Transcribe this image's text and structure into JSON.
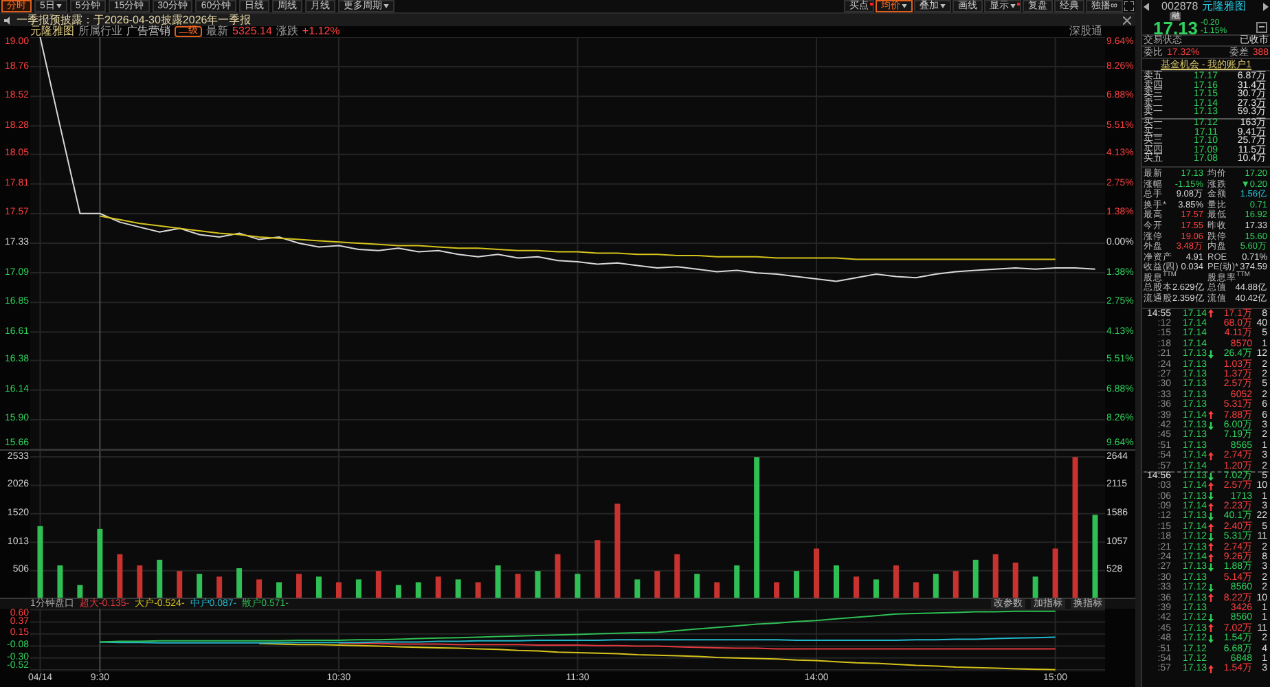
{
  "toolbar": {
    "periods": [
      {
        "label": "分时",
        "selected": true,
        "dropdown": false
      },
      {
        "label": "5日",
        "selected": false,
        "dropdown": true
      },
      {
        "label": "5分钟",
        "selected": false,
        "dropdown": false
      },
      {
        "label": "15分钟",
        "selected": false,
        "dropdown": false
      },
      {
        "label": "30分钟",
        "selected": false,
        "dropdown": false
      },
      {
        "label": "60分钟",
        "selected": false,
        "dropdown": false
      },
      {
        "label": "日线",
        "selected": false,
        "dropdown": false
      },
      {
        "label": "周线",
        "selected": false,
        "dropdown": false
      },
      {
        "label": "月线",
        "selected": false,
        "dropdown": false
      },
      {
        "label": "更多周期",
        "selected": false,
        "dropdown": true
      }
    ],
    "tools": [
      {
        "label": "买点",
        "selected": false,
        "dropdown": false,
        "dot": true
      },
      {
        "label": "均价",
        "selected": true,
        "dropdown": true,
        "dot": false
      },
      {
        "label": "叠加",
        "selected": false,
        "dropdown": true,
        "dot": false
      },
      {
        "label": "画线",
        "selected": false,
        "dropdown": false,
        "dot": false
      },
      {
        "label": "显示",
        "selected": false,
        "dropdown": true,
        "dot": true
      },
      {
        "label": "复盘",
        "selected": false,
        "dropdown": false,
        "dot": false
      },
      {
        "label": "经典",
        "selected": false,
        "dropdown": false,
        "dot": false
      },
      {
        "label": "独播∞",
        "selected": false,
        "dropdown": false,
        "dot": false
      }
    ]
  },
  "notice": {
    "text": "一季报预披露：于2026-04-30披露2026年一季报"
  },
  "stock_header": {
    "name": "元隆雅图",
    "industry_label": "所属行业",
    "industry": "广告营销",
    "level_badge": "二级",
    "latest_label": "最新",
    "latest": "5325.14",
    "change_label": "涨跌",
    "change": "+1.12%",
    "connect": "深股通"
  },
  "price_chart": {
    "chart_data": {
      "type": "line",
      "grid": true,
      "ylim": [
        15.66,
        19.0
      ],
      "yticks": [
        {
          "value": 19.0,
          "label": "19.00"
        },
        {
          "value": 18.76,
          "label": "18.76"
        },
        {
          "value": 18.52,
          "label": "18.52"
        },
        {
          "value": 18.28,
          "label": "18.28"
        },
        {
          "value": 18.05,
          "label": "18.05"
        },
        {
          "value": 17.81,
          "label": "17.81"
        },
        {
          "value": 17.57,
          "label": "17.57"
        },
        {
          "value": 17.33,
          "label": "17.33"
        },
        {
          "value": 17.09,
          "label": "17.09"
        },
        {
          "value": 16.85,
          "label": "16.85"
        },
        {
          "value": 16.61,
          "label": "16.61"
        },
        {
          "value": 16.38,
          "label": "16.38"
        },
        {
          "value": 16.14,
          "label": "16.14"
        },
        {
          "value": 15.9,
          "label": "15.90"
        },
        {
          "value": 15.66,
          "label": "15.66"
        }
      ],
      "series": [
        {
          "color": "#d9d9d9",
          "values": [
            19.0,
            18.28,
            17.57,
            17.57,
            17.5,
            17.46,
            17.42,
            17.45,
            17.4,
            17.38,
            17.41,
            17.36,
            17.38,
            17.33,
            17.3,
            17.31,
            17.28,
            17.27,
            17.29,
            17.26,
            17.27,
            17.24,
            17.22,
            17.24,
            17.21,
            17.22,
            17.19,
            17.18,
            17.16,
            17.17,
            17.15,
            17.13,
            17.14,
            17.12,
            17.1,
            17.11,
            17.09,
            17.08,
            17.06,
            17.04,
            17.02,
            17.05,
            17.08,
            17.06,
            17.05,
            17.08,
            17.1,
            17.11,
            17.12,
            17.13,
            17.12,
            17.13,
            17.13,
            17.12
          ]
        },
        {
          "color": "#d6c31c",
          "values": [
            null,
            null,
            null,
            17.55,
            17.52,
            17.49,
            17.47,
            17.45,
            17.43,
            17.41,
            17.4,
            17.38,
            17.37,
            17.36,
            17.35,
            17.34,
            17.33,
            17.32,
            17.31,
            17.31,
            17.3,
            17.29,
            17.29,
            17.28,
            17.27,
            17.27,
            17.26,
            17.26,
            17.25,
            17.25,
            17.24,
            17.24,
            17.23,
            17.23,
            17.22,
            17.22,
            17.22,
            17.21,
            17.21,
            17.21,
            17.21,
            17.2,
            17.2,
            17.2,
            17.2,
            17.2,
            17.2,
            17.2,
            17.2,
            17.2,
            17.2,
            17.2,
            null,
            null
          ]
        }
      ]
    },
    "pct_labels": [
      "9.64%",
      "8.26%",
      "6.88%",
      "5.51%",
      "4.13%",
      "2.75%",
      "1.38%",
      "0.00%",
      "1.38%",
      "2.75%",
      "4.13%",
      "5.51%",
      "6.88%",
      "8.26%",
      "9.64%"
    ]
  },
  "volume_chart": {
    "chart_data": {
      "type": "bar",
      "stacked": true,
      "grid": true,
      "ylim": [
        0,
        2644
      ],
      "yticks": [
        {
          "value": 2533,
          "label": "2533"
        },
        {
          "value": 2026,
          "label": "2026"
        },
        {
          "value": 1520,
          "label": "1520"
        },
        {
          "value": 1013,
          "label": "1013"
        },
        {
          "value": 506,
          "label": "506"
        }
      ],
      "series": [
        {
          "color": "#c8332f",
          "values": [
            null,
            null,
            null,
            null,
            800,
            600,
            null,
            500,
            null,
            400,
            null,
            350,
            null,
            450,
            null,
            300,
            null,
            500,
            null,
            null,
            400,
            null,
            300,
            null,
            450,
            null,
            800,
            null,
            1050,
            1700,
            null,
            500,
            800,
            null,
            300,
            null,
            null,
            300,
            null,
            900,
            null,
            400,
            null,
            600,
            300,
            null,
            500,
            null,
            800,
            650,
            null,
            900,
            2530,
            null
          ]
        },
        {
          "color": "#2fbf55",
          "values": [
            1300,
            600,
            250,
            1250,
            null,
            null,
            700,
            null,
            450,
            null,
            550,
            null,
            300,
            null,
            400,
            null,
            350,
            null,
            250,
            300,
            null,
            350,
            null,
            600,
            null,
            500,
            null,
            450,
            null,
            null,
            350,
            null,
            null,
            450,
            null,
            600,
            2530,
            null,
            500,
            null,
            600,
            null,
            350,
            null,
            null,
            450,
            null,
            700,
            null,
            null,
            400,
            null,
            null,
            1500
          ]
        }
      ]
    },
    "right_labels": [
      "2644",
      "2115",
      "1586",
      "1057",
      "528"
    ]
  },
  "indicator": {
    "title": "1分钟盘口",
    "legend": [
      "-0.135-",
      "-0.524-",
      "0.087-",
      "0.571-"
    ],
    "actions": [
      "改参数",
      "加指标",
      "换指标"
    ],
    "chart_data": {
      "type": "line",
      "grid": true,
      "ylim": [
        -0.56,
        0.62
      ],
      "yticks": [
        {
          "value": 0.6,
          "label": "0.60"
        },
        {
          "value": 0.37,
          "label": "0.37"
        },
        {
          "value": 0.15,
          "label": "0.15"
        },
        {
          "value": -0.08,
          "label": "-0.08"
        },
        {
          "value": -0.3,
          "label": "-0.30"
        },
        {
          "value": -0.52,
          "label": "-0.52"
        }
      ],
      "categories": [
        "04/14",
        null,
        null,
        "9:30",
        null,
        null,
        null,
        null,
        null,
        null,
        null,
        null,
        null,
        null,
        null,
        "10:30",
        null,
        null,
        null,
        null,
        null,
        null,
        null,
        null,
        null,
        null,
        null,
        "11:30",
        null,
        null,
        null,
        null,
        null,
        null,
        null,
        null,
        null,
        null,
        null,
        "14:00",
        null,
        null,
        null,
        null,
        null,
        null,
        null,
        null,
        null,
        null,
        null,
        "15:00",
        null,
        null
      ],
      "series": [
        {
          "name": "超大",
          "color": "#e0393e",
          "values": [
            null,
            null,
            null,
            null,
            null,
            null,
            null,
            null,
            null,
            null,
            null,
            null,
            null,
            null,
            null,
            -0.02,
            -0.03,
            -0.03,
            -0.04,
            -0.04,
            -0.04,
            -0.05,
            -0.05,
            -0.05,
            -0.05,
            -0.06,
            -0.06,
            -0.06,
            -0.07,
            -0.07,
            -0.08,
            -0.08,
            -0.09,
            -0.1,
            -0.11,
            -0.12,
            -0.12,
            -0.13,
            -0.13,
            -0.13,
            -0.13,
            -0.13,
            -0.13,
            -0.13,
            -0.13,
            -0.13,
            -0.13,
            -0.13,
            -0.13,
            -0.13,
            -0.13,
            -0.13,
            null,
            null
          ]
        },
        {
          "name": "大户",
          "color": "#d6c31c",
          "values": [
            null,
            null,
            null,
            null,
            null,
            null,
            null,
            null,
            null,
            null,
            null,
            -0.03,
            -0.04,
            -0.05,
            -0.05,
            -0.06,
            -0.07,
            -0.08,
            -0.09,
            -0.1,
            -0.11,
            -0.12,
            -0.13,
            -0.14,
            -0.16,
            -0.17,
            -0.19,
            -0.2,
            -0.21,
            -0.22,
            -0.24,
            -0.25,
            -0.26,
            -0.27,
            -0.29,
            -0.3,
            -0.31,
            -0.32,
            -0.34,
            -0.35,
            -0.37,
            -0.39,
            -0.4,
            -0.42,
            -0.44,
            -0.45,
            -0.47,
            -0.48,
            -0.49,
            -0.5,
            -0.51,
            -0.52,
            null,
            null
          ]
        },
        {
          "name": "中户",
          "color": "#22b8cc",
          "values": [
            null,
            null,
            null,
            0,
            -0.01,
            -0.01,
            -0.02,
            -0.02,
            -0.02,
            -0.02,
            -0.02,
            -0.02,
            -0.02,
            -0.01,
            -0.01,
            -0.01,
            -0.01,
            0,
            0,
            0,
            0.01,
            0.01,
            0.02,
            0.02,
            0.02,
            0.03,
            0.03,
            0.03,
            0.03,
            0.04,
            0.04,
            0.04,
            0.04,
            0.04,
            0.04,
            0.04,
            0.04,
            0.04,
            0.03,
            0.03,
            0.03,
            0.03,
            0.03,
            0.03,
            0.04,
            0.04,
            0.05,
            0.05,
            0.06,
            0.07,
            0.08,
            0.09,
            null,
            null
          ]
        },
        {
          "name": "散户",
          "color": "#2fbf55",
          "values": [
            null,
            null,
            null,
            0,
            0.01,
            0.01,
            0.02,
            0.02,
            0.02,
            0.02,
            0.02,
            0.02,
            0.02,
            0.03,
            0.03,
            0.03,
            0.04,
            0.04,
            0.05,
            0.06,
            0.07,
            0.08,
            0.09,
            0.1,
            0.11,
            0.12,
            0.13,
            0.14,
            0.15,
            0.16,
            0.17,
            0.18,
            0.21,
            0.24,
            0.27,
            0.3,
            0.33,
            0.35,
            0.38,
            0.4,
            0.43,
            0.46,
            0.49,
            0.52,
            0.53,
            0.54,
            0.55,
            0.56,
            0.56,
            0.57,
            0.57,
            0.57,
            null,
            null
          ]
        }
      ]
    }
  },
  "quote": {
    "code": "002878",
    "name": "元隆雅图",
    "badge": "融",
    "price": "17.13",
    "change": "-0.20",
    "change_pct": "-1.15%"
  },
  "status": {
    "label": "交易状态",
    "value": "已收市"
  },
  "ratio": [
    {
      "label": "委比",
      "value": "17.32%"
    },
    {
      "label": "委差",
      "value": "388"
    }
  ],
  "link": "基金机会 - 我的账户1",
  "order_book": {
    "asks": [
      {
        "label": "卖五",
        "price": "17.17",
        "volume": "6.87万"
      },
      {
        "label": "卖四",
        "price": "17.16",
        "volume": "31.4万"
      },
      {
        "label": "卖三",
        "price": "17.15",
        "volume": "30.7万"
      },
      {
        "label": "卖二",
        "price": "17.14",
        "volume": "27.3万"
      },
      {
        "label": "卖一",
        "price": "17.13",
        "volume": "59.3万"
      }
    ],
    "bids": [
      {
        "label": "买一",
        "price": "17.12",
        "volume": "163万"
      },
      {
        "label": "买二",
        "price": "17.11",
        "volume": "9.41万"
      },
      {
        "label": "买三",
        "price": "17.10",
        "volume": "25.7万"
      },
      {
        "label": "买四",
        "price": "17.09",
        "volume": "11.5万"
      },
      {
        "label": "买五",
        "price": "17.08",
        "volume": "10.4万"
      }
    ]
  },
  "stats": [
    {
      "left": {
        "label": "最新",
        "value": "17.13",
        "color": "#2fd25c"
      },
      "right": {
        "label": "均价",
        "value": "17.20",
        "color": "#2fd25c"
      }
    },
    {
      "left": {
        "label": "涨幅",
        "value": "-1.15%",
        "color": "#2fd25c"
      },
      "right": {
        "label": "涨跌",
        "value": "▼0.20",
        "color": "#2fd25c"
      }
    },
    {
      "left": {
        "label": "总手",
        "value": "9.08万",
        "color": "#d8d8d8"
      },
      "right": {
        "label": "金额",
        "value": "1.56亿",
        "color": "#22c7e0"
      }
    },
    {
      "left": {
        "label": "换手*",
        "value": "3.85%",
        "color": "#d8d8d8"
      },
      "right": {
        "label": "量比",
        "value": "0.71",
        "color": "#2fd25c"
      }
    },
    {
      "left": {
        "label": "最高",
        "value": "17.57",
        "color": "#ff4040"
      },
      "right": {
        "label": "最低",
        "value": "16.92",
        "color": "#2fd25c"
      }
    },
    {
      "left": {
        "label": "今开",
        "value": "17.55",
        "color": "#ff4040"
      },
      "right": {
        "label": "昨收",
        "value": "17.33",
        "color": "#d8d8d8"
      }
    },
    {
      "left": {
        "label": "涨停",
        "value": "19.06",
        "color": "#ff4040"
      },
      "right": {
        "label": "跌停",
        "value": "15.60",
        "color": "#2fd25c"
      }
    },
    {
      "left": {
        "label": "外盘",
        "value": "3.48万",
        "color": "#ff4040"
      },
      "right": {
        "label": "内盘",
        "value": "5.60万",
        "color": "#2fd25c"
      }
    },
    {
      "left": {
        "label": "净资产",
        "value": "4.91",
        "color": "#d8d8d8"
      },
      "right": {
        "label": "ROE",
        "value": "0.71%",
        "color": "#d8d8d8"
      }
    },
    {
      "left": {
        "label": "收益(四)",
        "value": "0.034",
        "color": "#d8d8d8"
      },
      "right": {
        "label": "PE(动)*",
        "value": "374.59",
        "color": "#d8d8d8"
      }
    },
    {
      "left": {
        "label": "股息$^{TTM}$"
      },
      "right": {
        "label": "股息率$^{TTM}$"
      }
    },
    {
      "left": {
        "label": "总股本",
        "value": "2.629亿",
        "color": "#d8d8d8"
      },
      "right": {
        "label": "总值",
        "value": "44.88亿",
        "color": "#d8d8d8"
      }
    },
    {
      "left": {
        "label": "流通股",
        "value": "2.359亿",
        "color": "#d8d8d8"
      },
      "right": {
        "label": "流值",
        "value": "40.42亿",
        "color": "#d8d8d8"
      }
    }
  ],
  "ticks": [
    {
      "new_minute": true,
      "time": "14:55",
      "price": "17.14",
      "kind": "up",
      "volume": "17.1万",
      "color": "#ff4040",
      "count": "8"
    },
    {
      "new_minute": false,
      "time": ":12",
      "price": "17.14",
      "kind": "flat",
      "volume": "68.0万",
      "color": "#ff4040",
      "count": "40"
    },
    {
      "new_minute": false,
      "time": ":15",
      "price": "17.14",
      "kind": "flat",
      "volume": "4.11万",
      "color": "#ff4040",
      "count": "5"
    },
    {
      "new_minute": false,
      "time": ":18",
      "price": "17.14",
      "kind": "flat",
      "volume": "8570",
      "color": "#ff4040",
      "count": "1"
    },
    {
      "new_minute": false,
      "time": ":21",
      "price": "17.13",
      "kind": "down",
      "volume": "26.4万",
      "color": "#2fd25c",
      "count": "12"
    },
    {
      "new_minute": false,
      "time": ":24",
      "price": "17.13",
      "kind": "flat",
      "volume": "1.03万",
      "color": "#ff4040",
      "count": "2"
    },
    {
      "new_minute": false,
      "time": ":27",
      "price": "17.13",
      "kind": "flat",
      "volume": "1.37万",
      "color": "#ff4040",
      "count": "2"
    },
    {
      "new_minute": false,
      "time": ":30",
      "price": "17.13",
      "kind": "flat",
      "volume": "2.57万",
      "color": "#ff4040",
      "count": "5"
    },
    {
      "new_minute": false,
      "time": ":33",
      "price": "17.13",
      "kind": "flat",
      "volume": "6052",
      "color": "#ff4040",
      "count": "2"
    },
    {
      "new_minute": false,
      "time": ":36",
      "price": "17.13",
      "kind": "flat",
      "volume": "5.31万",
      "color": "#ff4040",
      "count": "6"
    },
    {
      "new_minute": false,
      "time": ":39",
      "price": "17.14",
      "kind": "up",
      "volume": "7.88万",
      "color": "#ff4040",
      "count": "6"
    },
    {
      "new_minute": false,
      "time": ":42",
      "price": "17.13",
      "kind": "down",
      "volume": "6.00万",
      "color": "#2fd25c",
      "count": "3"
    },
    {
      "new_minute": false,
      "time": ":45",
      "price": "17.13",
      "kind": "flat",
      "volume": "7.19万",
      "color": "#2fd25c",
      "count": "2"
    },
    {
      "new_minute": false,
      "time": ":51",
      "price": "17.13",
      "kind": "flat",
      "volume": "8565",
      "color": "#2fd25c",
      "count": "1"
    },
    {
      "new_minute": false,
      "time": ":54",
      "price": "17.14",
      "kind": "up",
      "volume": "2.74万",
      "color": "#ff4040",
      "count": "3"
    },
    {
      "new_minute": false,
      "time": ":57",
      "price": "17.14",
      "kind": "flat",
      "volume": "1.20万",
      "color": "#ff4040",
      "count": "2"
    },
    {
      "new_minute": true,
      "time": "14:56",
      "price": "17.13",
      "kind": "down",
      "volume": "7.02万",
      "color": "#2fd25c",
      "count": "5"
    },
    {
      "new_minute": false,
      "time": ":03",
      "price": "17.14",
      "kind": "up",
      "volume": "2.57万",
      "color": "#ff4040",
      "count": "10"
    },
    {
      "new_minute": false,
      "time": ":06",
      "price": "17.13",
      "kind": "down",
      "volume": "1713",
      "color": "#2fd25c",
      "count": "1"
    },
    {
      "new_minute": false,
      "time": ":09",
      "price": "17.14",
      "kind": "up",
      "volume": "2.23万",
      "color": "#ff4040",
      "count": "3"
    },
    {
      "new_minute": false,
      "time": ":12",
      "price": "17.13",
      "kind": "down",
      "volume": "40.1万",
      "color": "#2fd25c",
      "count": "22"
    },
    {
      "new_minute": false,
      "time": ":15",
      "price": "17.14",
      "kind": "up",
      "volume": "2.40万",
      "color": "#ff4040",
      "count": "5"
    },
    {
      "new_minute": false,
      "time": ":18",
      "price": "17.12",
      "kind": "down",
      "volume": "5.31万",
      "color": "#2fd25c",
      "count": "11"
    },
    {
      "new_minute": false,
      "time": ":21",
      "price": "17.13",
      "kind": "up",
      "volume": "2.74万",
      "color": "#ff4040",
      "count": "2"
    },
    {
      "new_minute": false,
      "time": ":24",
      "price": "17.14",
      "kind": "up",
      "volume": "9.26万",
      "color": "#ff4040",
      "count": "8"
    },
    {
      "new_minute": false,
      "time": ":27",
      "price": "17.13",
      "kind": "down",
      "volume": "1.88万",
      "color": "#2fd25c",
      "count": "3"
    },
    {
      "new_minute": false,
      "time": ":30",
      "price": "17.13",
      "kind": "flat",
      "volume": "5.14万",
      "color": "#ff4040",
      "count": "2"
    },
    {
      "new_minute": false,
      "time": ":33",
      "price": "17.12",
      "kind": "down",
      "volume": "8560",
      "color": "#2fd25c",
      "count": "2"
    },
    {
      "new_minute": false,
      "time": ":36",
      "price": "17.13",
      "kind": "up",
      "volume": "8.22万",
      "color": "#ff4040",
      "count": "10"
    },
    {
      "new_minute": false,
      "time": ":39",
      "price": "17.13",
      "kind": "flat",
      "volume": "3426",
      "color": "#ff4040",
      "count": "1"
    },
    {
      "new_minute": false,
      "time": ":42",
      "price": "17.12",
      "kind": "down",
      "volume": "8560",
      "color": "#2fd25c",
      "count": "1"
    },
    {
      "new_minute": false,
      "time": ":45",
      "price": "17.13",
      "kind": "up",
      "volume": "7.02万",
      "color": "#ff4040",
      "count": "11"
    },
    {
      "new_minute": false,
      "time": ":48",
      "price": "17.12",
      "kind": "down",
      "volume": "1.54万",
      "color": "#2fd25c",
      "count": "2"
    },
    {
      "new_minute": false,
      "time": ":51",
      "price": "17.12",
      "kind": "flat",
      "volume": "6.68万",
      "color": "#2fd25c",
      "count": "4"
    },
    {
      "new_minute": false,
      "time": ":54",
      "price": "17.12",
      "kind": "flat",
      "volume": "6848",
      "color": "#2fd25c",
      "count": "1"
    },
    {
      "new_minute": false,
      "time": ":57",
      "price": "17.13",
      "kind": "up",
      "volume": "1.54万",
      "color": "#ff4040",
      "count": "3"
    }
  ]
}
